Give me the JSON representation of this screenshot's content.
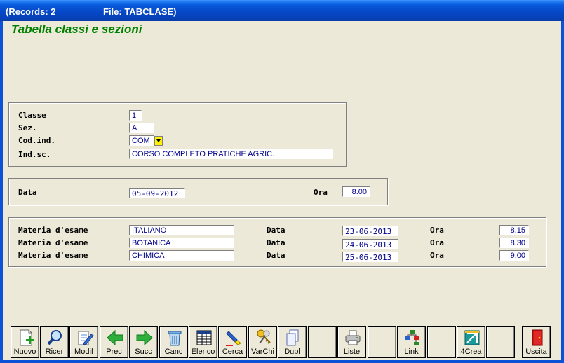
{
  "window": {
    "records": "(Records: 2",
    "file": "File: TABCLASE)"
  },
  "heading": "Tabella classi e sezioni",
  "classe_group": {
    "classe_label": "Classe",
    "classe_value": "1",
    "sez_label": "Sez.",
    "sez_value": "A",
    "codind_label": "Cod.ind.",
    "codind_value": "COM",
    "indsc_label": "Ind.sc.",
    "indsc_value": "CORSO COMPLETO PRATICHE AGRIC."
  },
  "data_group": {
    "data_label": "Data",
    "data_value": "05-09-2012",
    "ora_label": "Ora",
    "ora_value": "8.00"
  },
  "esami": {
    "rows": [
      {
        "materia_label": "Materia d'esame",
        "materia": "ITALIANO",
        "data_label": "Data",
        "data": "23-06-2013",
        "ora_label": "Ora",
        "ora": "8.15"
      },
      {
        "materia_label": "Materia d'esame",
        "materia": "BOTANICA",
        "data_label": "Data",
        "data": "24-06-2013",
        "ora_label": "Ora",
        "ora": "8.30"
      },
      {
        "materia_label": "Materia d'esame",
        "materia": "CHIMICA",
        "data_label": "Data",
        "data": "25-06-2013",
        "ora_label": "Ora",
        "ora": "9.00"
      }
    ]
  },
  "toolbar": {
    "nuovo": "Nuovo",
    "ricer": "Ricer",
    "modif": "Modif",
    "prec": "Prec",
    "succ": "Succ",
    "canc": "Canc",
    "elenco": "Elenco",
    "cerca": "Cerca",
    "varchi": "VarChi",
    "dupl": "Dupl",
    "liste": "Liste",
    "link": "Link",
    "crea": "4Crea",
    "uscita": "Uscita"
  },
  "colors": {
    "title_bar": "#0548c8",
    "heading": "#008000",
    "field_text": "#00008b",
    "dropdown": "#fff200"
  }
}
